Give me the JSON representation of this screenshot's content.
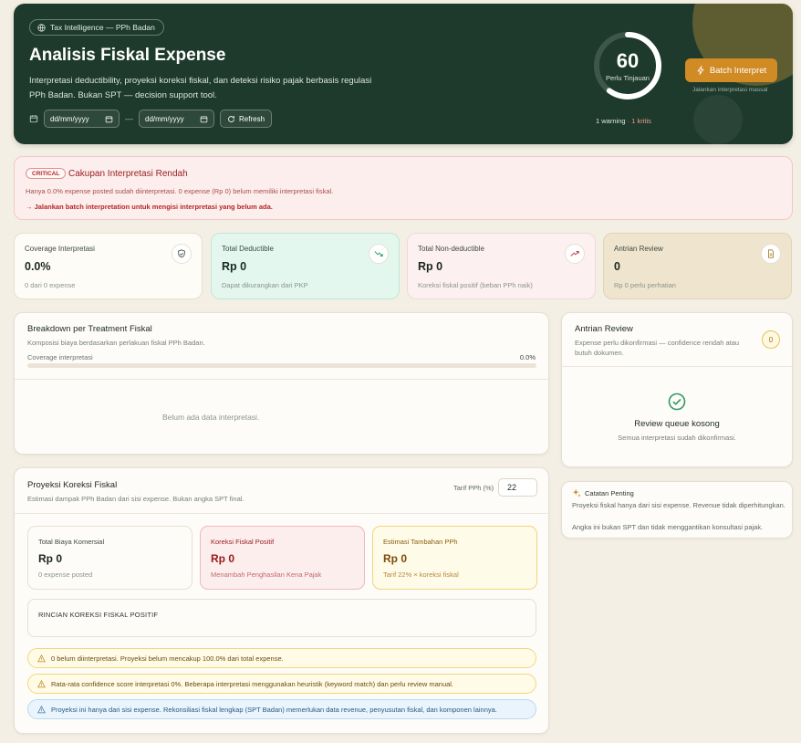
{
  "header": {
    "pill": "Tax Intelligence — PPh Badan",
    "title": "Analisis Fiskal Expense",
    "desc": "Interpretasi deductibility, proyeksi koreksi fiskal, dan deteksi risiko pajak berbasis regulasi PPh Badan. Bukan SPT — decision support tool.",
    "date_from_placeholder": "dd/mm/yyyy",
    "date_to_placeholder": "dd/mm/yyyy",
    "date_sep": "—",
    "refresh_label": "Refresh",
    "score": "60",
    "score_fraction": 0.6,
    "score_label": "Perlu Tinjauan",
    "warning_text": "1 warning",
    "critical_text": "· 1 kritis",
    "batch_label": "Batch Interpret",
    "batch_sub": "Jalankan interpretasi massal"
  },
  "alert": {
    "badge": "CRITICAL",
    "title": "Cakupan Interpretasi Rendah",
    "line1": "Hanya 0.0% expense posted sudah diinterpretasi. 0 expense (Rp 0) belum memiliki interpretasi fiskal.",
    "line2": "→ Jalankan batch interpretation untuk mengisi interpretasi yang belum ada."
  },
  "stats": [
    {
      "title": "Coverage Interpretasi",
      "value": "0.0%",
      "sub": "0 dari 0 expense",
      "icon": "shield-check-icon"
    },
    {
      "title": "Total Deductible",
      "value": "Rp 0",
      "sub": "Dapat dikurangkan dari PKP",
      "icon": "trend-down-icon"
    },
    {
      "title": "Total Non-deductible",
      "value": "Rp 0",
      "sub": "Koreksi fiskal positif (beban PPh naik)",
      "icon": "trend-up-icon"
    },
    {
      "title": "Antrian Review",
      "value": "0",
      "sub": "Rp 0 perlu perhatian",
      "icon": "document-icon"
    }
  ],
  "breakdown": {
    "title": "Breakdown per Treatment Fiskal",
    "sub": "Komposisi biaya berdasarkan perlakuan fiskal PPh Badan.",
    "coverage_label": "Coverage interpretasi",
    "coverage_value": "0.0%",
    "coverage_fraction": 0,
    "empty": "Belum ada data interpretasi."
  },
  "review": {
    "title": "Antrian Review",
    "sub": "Expense perlu dikonfirmasi — confidence rendah atau butuh dokumen.",
    "count": "0",
    "empty_title": "Review queue kosong",
    "empty_sub": "Semua interpretasi sudah dikonfirmasi."
  },
  "note": {
    "title": "Catatan Penting",
    "line1": "Proyeksi fiskal hanya dari sisi expense. Revenue tidak diperhitungkan.",
    "line2": "Angka ini bukan SPT dan tidak menggantikan konsultasi pajak."
  },
  "projection": {
    "title": "Proyeksi Koreksi Fiskal",
    "sub": "Estimasi dampak PPh Badan dari sisi expense. Bukan angka SPT final.",
    "tarif_label": "Tarif PPh (%)",
    "tarif_value": "22",
    "cards": [
      {
        "title": "Total Biaya Komersial",
        "value": "Rp 0",
        "sub": "0 expense posted"
      },
      {
        "title": "Koreksi Fiskal Positif",
        "value": "Rp 0",
        "sub": "Menambah Penghasilan Kena Pajak"
      },
      {
        "title": "Estimasi Tambahan PPh",
        "value": "Rp 0",
        "sub": "Tarif 22% × koreksi fiskal"
      }
    ],
    "rincian_title": "RINCIAN KOREKSI FISKAL POSITIF",
    "warnings": [
      "0 belum diinterpretasi. Proyeksi belum mencakup 100.0% dari total expense.",
      "Rata-rata confidence score interpretasi 0%. Beberapa interpretasi menggunakan heuristik (keyword match) dan perlu review manual.",
      "Proyeksi ini hanya dari sisi expense. Rekonsiliasi fiskal lengkap (SPT Badan) memerlukan data revenue, penyusutan fiskal, dan komponen lainnya."
    ]
  },
  "colors": {
    "hero_bg": "#1d3a2c",
    "accent": "#d18b25",
    "critical": "#b22a2a",
    "success": "#2f9a62"
  }
}
